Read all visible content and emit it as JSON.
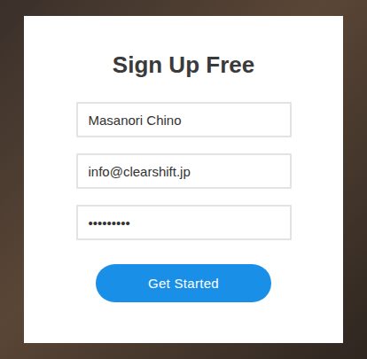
{
  "form": {
    "title": "Sign Up Free",
    "fields": [
      {
        "name": "name",
        "value": "Masanori Chino"
      },
      {
        "name": "email",
        "value": "info@clearshift.jp"
      },
      {
        "name": "password",
        "value": "•••••••••"
      }
    ],
    "button": "Get Started"
  }
}
